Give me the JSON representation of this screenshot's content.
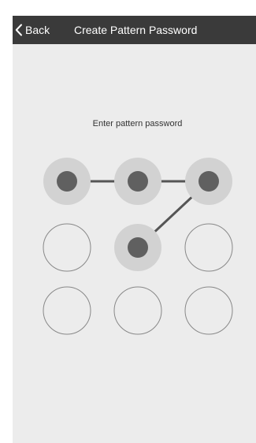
{
  "nav": {
    "back_label": "Back",
    "title": "Create Pattern Password"
  },
  "prompt": "Enter pattern password",
  "pattern": {
    "selected_dots": [
      1,
      2,
      3,
      5
    ],
    "sequence": [
      1,
      2,
      3,
      5
    ]
  },
  "colors": {
    "nav_background": "#3a3a3a",
    "screen_background": "#ececec",
    "selected_ring": "#d2d2d2",
    "selected_center": "#606060",
    "connector": "#555555",
    "empty_dot_stroke": "#888888"
  }
}
